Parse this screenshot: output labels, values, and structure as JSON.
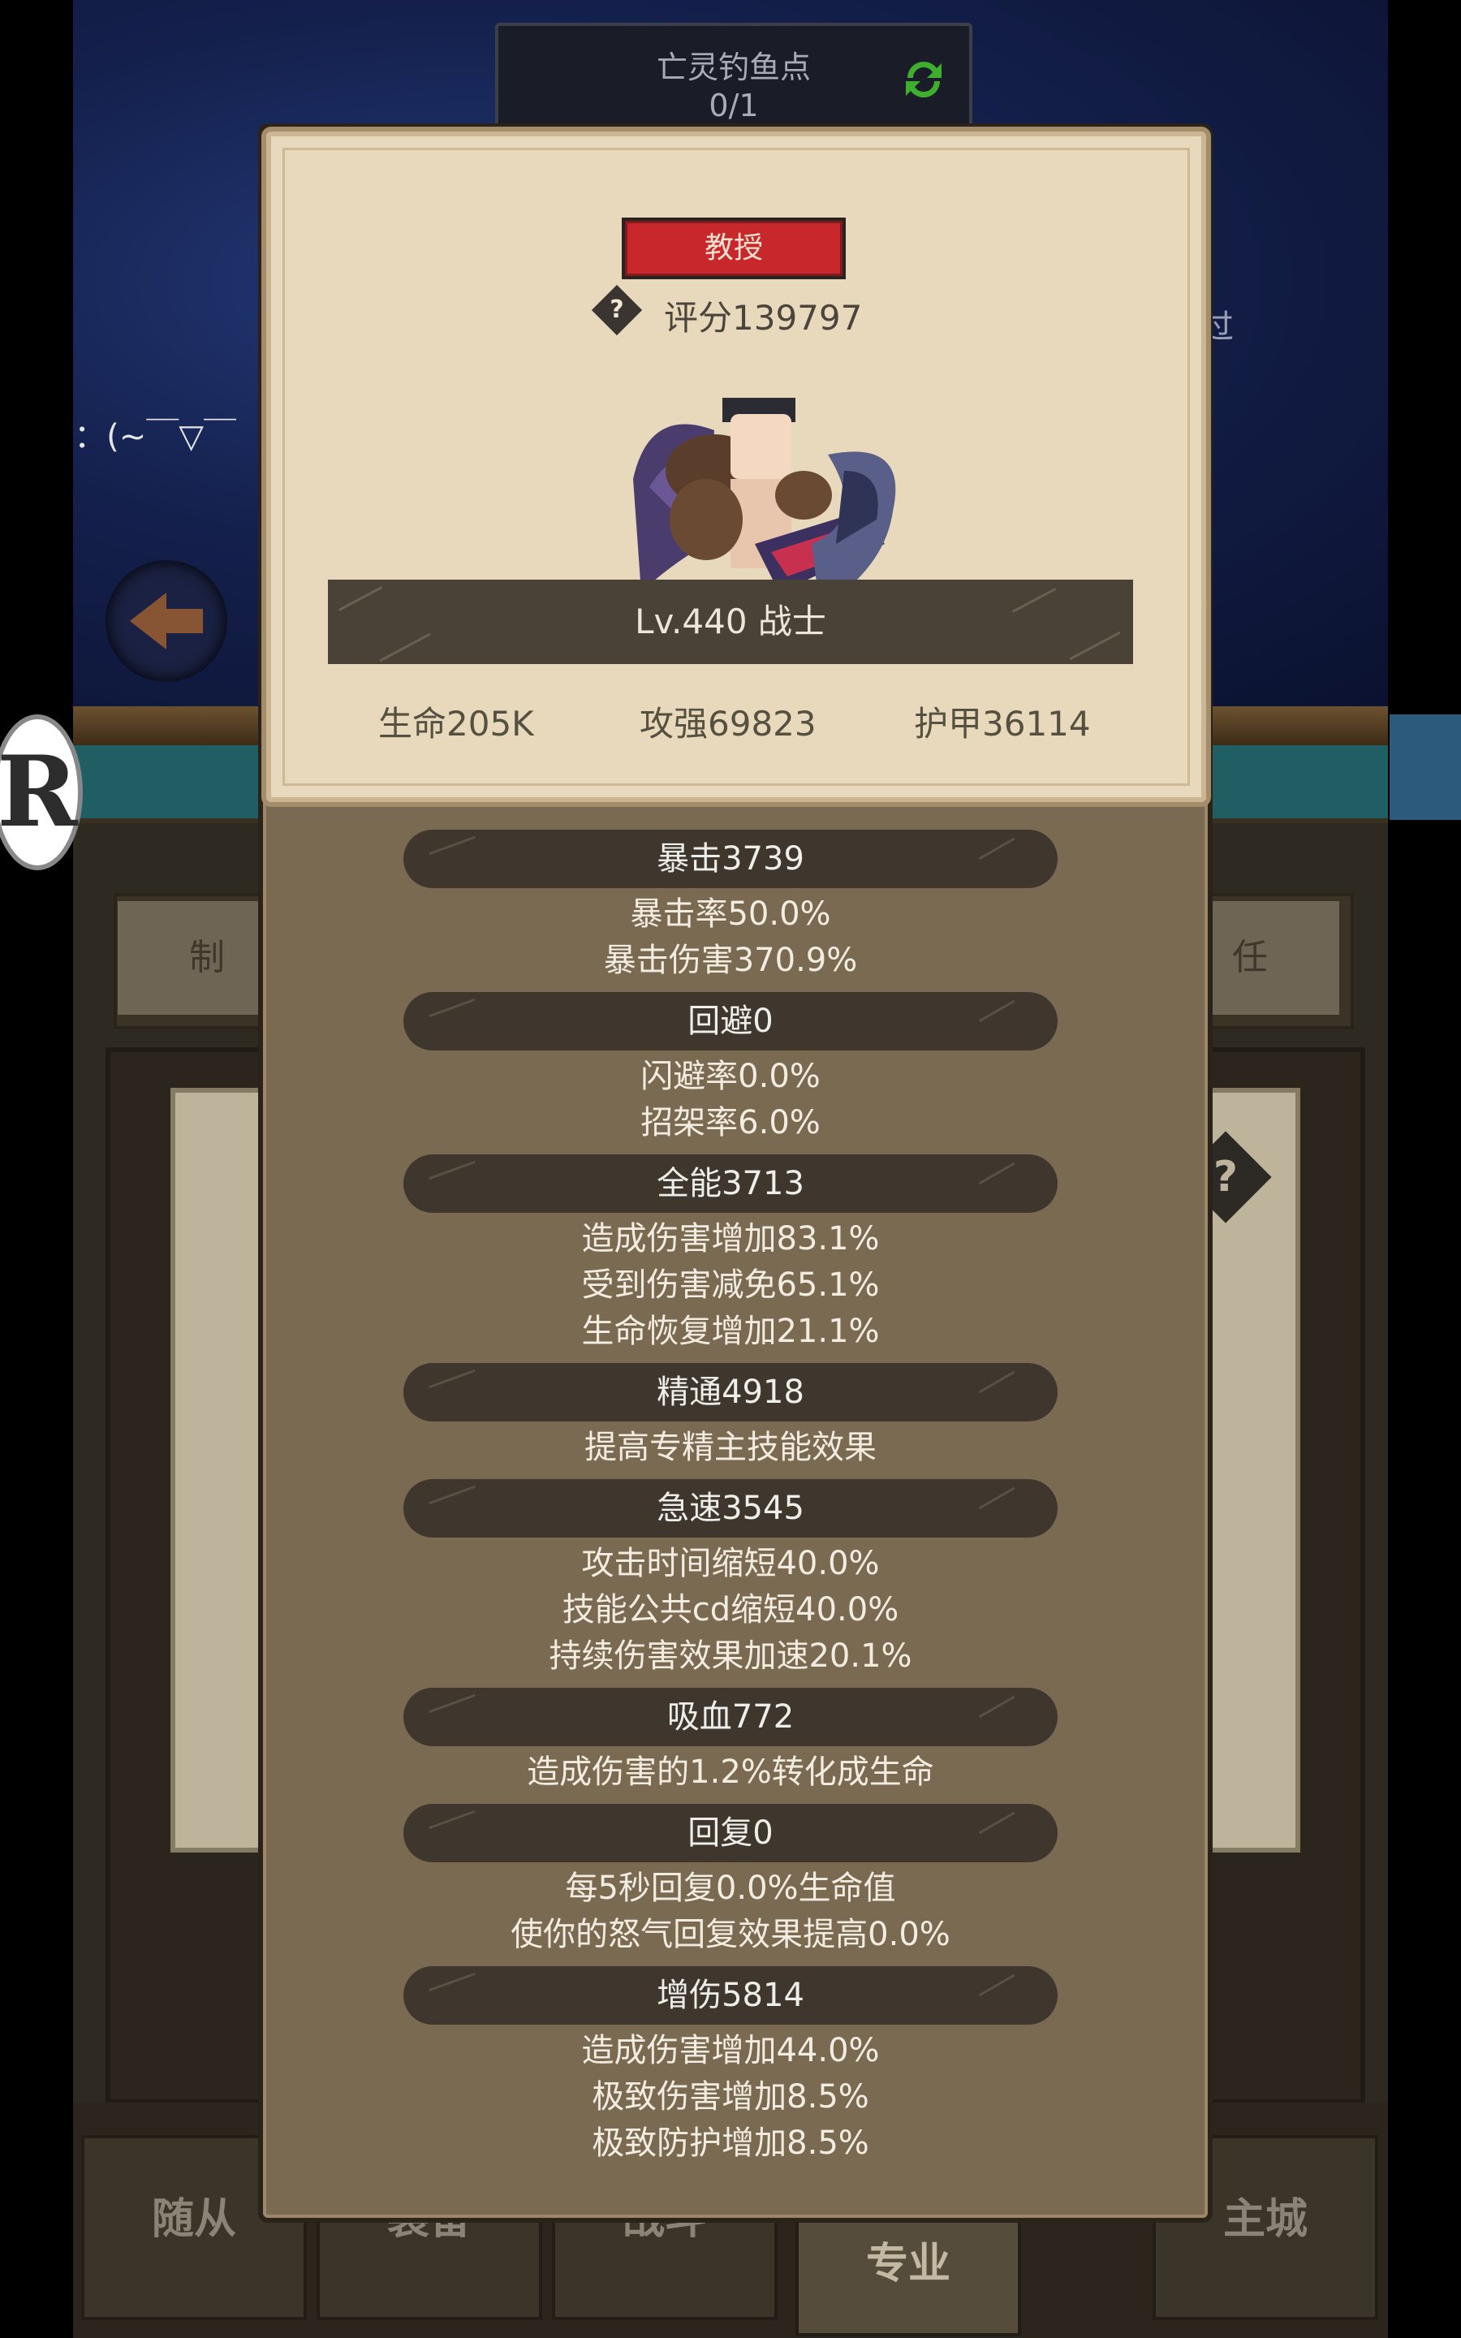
{
  "background": {
    "fishing_title": "亡灵钓鱼点",
    "fishing_count": "0/1",
    "pass_text": "过",
    "chat_text": "i冬菜：(~￣▽￣",
    "tab_left": "制",
    "tab_right": "任",
    "help_mark": "?",
    "logo_letter": "R",
    "nav": [
      "随从",
      "装备",
      "战斗",
      "专业",
      "主城"
    ]
  },
  "popup": {
    "rank": "教授",
    "score_icon": "?",
    "score": "评分139797",
    "level": "Lv.440 战士",
    "hp": "生命205K",
    "attack": "攻强69823",
    "armor": "护甲36114"
  },
  "stat_sections": [
    {
      "header": "暴击3739",
      "lines": [
        "暴击率50.0%",
        "暴击伤害370.9%"
      ]
    },
    {
      "header": "回避0",
      "lines": [
        "闪避率0.0%",
        "招架率6.0%"
      ]
    },
    {
      "header": "全能3713",
      "lines": [
        "造成伤害增加83.1%",
        "受到伤害减免65.1%",
        "生命恢复增加21.1%"
      ]
    },
    {
      "header": "精通4918",
      "lines": [
        "提高专精主技能效果"
      ]
    },
    {
      "header": "急速3545",
      "lines": [
        "攻击时间缩短40.0%",
        "技能公共cd缩短40.0%",
        "持续伤害效果加速20.1%"
      ]
    },
    {
      "header": "吸血772",
      "lines": [
        "造成伤害的1.2%转化成生命"
      ]
    },
    {
      "header": "回复0",
      "lines": [
        "每5秒回复0.0%生命值",
        "使你的怒气回复效果提高0.0%"
      ]
    },
    {
      "header": "增伤5814",
      "lines": [
        "造成伤害增加44.0%",
        "极致伤害增加8.5%",
        "极致防护增加8.5%"
      ]
    }
  ],
  "colors": {
    "badge_red": "#c8282b",
    "parchment": "#e8d9bd",
    "panel_brown": "#7b6a52",
    "header_dark": "#3f372e"
  }
}
